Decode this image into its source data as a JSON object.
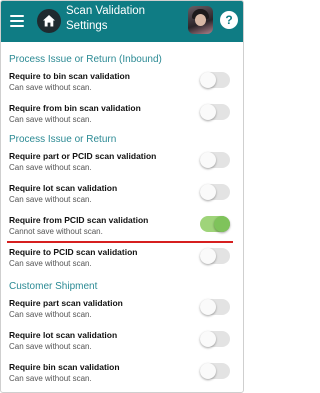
{
  "header": {
    "title": "Scan Validation Settings",
    "help_label": "?",
    "menu_icon": "hamburger-menu-icon",
    "home_icon": "home-icon",
    "colors": {
      "bar": "#0f7c84",
      "home": "#1f2a2f"
    }
  },
  "sections": [
    {
      "title": "Process Issue or Return (Inbound)",
      "items": [
        {
          "label": "Require to bin scan validation",
          "sub": "Can save without scan.",
          "on": false
        },
        {
          "label": "Require from bin scan validation",
          "sub": "Can save without scan.",
          "on": false
        }
      ]
    },
    {
      "title": "Process Issue or Return",
      "items": [
        {
          "label": "Require part or PCID scan validation",
          "sub": "Can save without scan.",
          "on": false
        },
        {
          "label": "Require lot scan validation",
          "sub": "Can save without scan.",
          "on": false
        },
        {
          "label": "Require from PCID scan validation",
          "sub": "Cannot save without scan.",
          "on": true
        },
        {
          "label": "Require to PCID scan validation",
          "sub": "Can save without scan.",
          "on": false
        }
      ]
    },
    {
      "title": "Customer Shipment",
      "items": [
        {
          "label": "Require part scan validation",
          "sub": "Can save without scan.",
          "on": false
        },
        {
          "label": "Require lot scan validation",
          "sub": "Can save without scan.",
          "on": false
        },
        {
          "label": "Require bin scan validation",
          "sub": "Can save without scan.",
          "on": false
        }
      ]
    }
  ],
  "colors": {
    "section_title": "#2b8a94",
    "toggle_on": "#7fc35b",
    "highlight_line": "#d61f1f"
  }
}
